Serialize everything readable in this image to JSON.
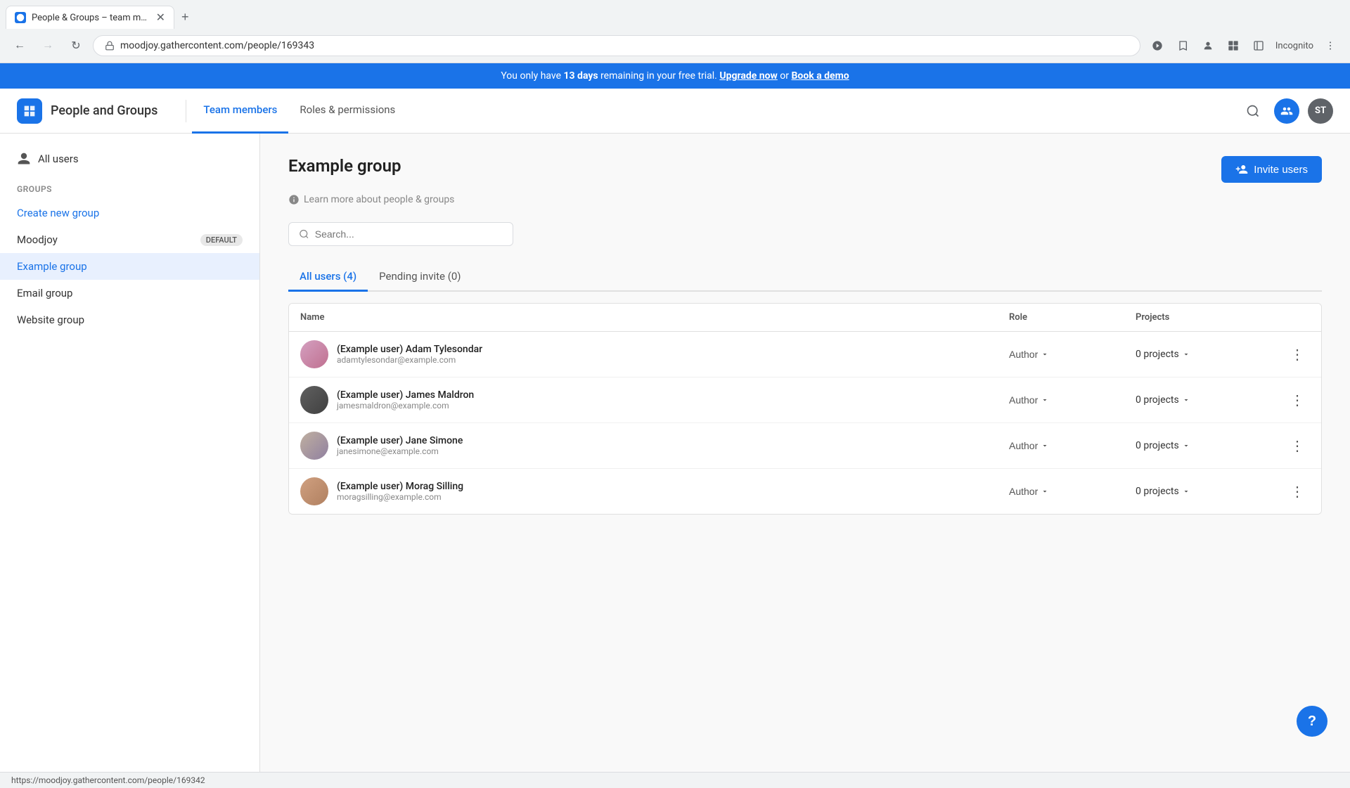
{
  "browser": {
    "tab_title": "People & Groups – team mem…",
    "favicon": "●",
    "url": "moodjoy.gathercontent.com/people/169343",
    "new_tab_label": "+",
    "back_disabled": false,
    "forward_disabled": true,
    "incognito_label": "Incognito"
  },
  "banner": {
    "text_prefix": "You only have ",
    "days": "13 days",
    "text_middle": " remaining in your free trial. ",
    "upgrade_label": "Upgrade now",
    "text_or": " or ",
    "demo_label": "Book a demo"
  },
  "header": {
    "app_name": "People and Groups",
    "nav_items": [
      {
        "id": "team-members",
        "label": "Team members",
        "active": true
      },
      {
        "id": "roles-permissions",
        "label": "Roles & permissions",
        "active": false
      }
    ],
    "user_initials": "ST"
  },
  "sidebar": {
    "all_users_label": "All users",
    "groups_section_label": "GROUPS",
    "create_group_label": "Create new group",
    "groups": [
      {
        "id": "moodjoy",
        "label": "Moodjoy",
        "badge": "DEFAULT",
        "active": false
      },
      {
        "id": "example-group",
        "label": "Example group",
        "active": true
      },
      {
        "id": "email-group",
        "label": "Email group",
        "active": false
      },
      {
        "id": "website-group",
        "label": "Website group",
        "active": false
      }
    ]
  },
  "content": {
    "group_title": "Example group",
    "learn_more_label": "Learn more about people & groups",
    "search_placeholder": "Search...",
    "invite_btn_label": "Invite users",
    "tabs": [
      {
        "id": "all-users",
        "label": "All users (4)",
        "active": true
      },
      {
        "id": "pending-invite",
        "label": "Pending invite (0)",
        "active": false
      }
    ],
    "table": {
      "headers": [
        "Name",
        "Role",
        "Projects",
        ""
      ],
      "rows": [
        {
          "id": "adam",
          "name": "(Example user) Adam Tylesondar",
          "email": "adamtylesondar@example.com",
          "role": "Author",
          "projects": "0 projects",
          "avatar_class": "avatar-adam"
        },
        {
          "id": "james",
          "name": "(Example user) James Maldron",
          "email": "jamesmaldron@example.com",
          "role": "Author",
          "projects": "0 projects",
          "avatar_class": "avatar-james"
        },
        {
          "id": "jane",
          "name": "(Example user) Jane Simone",
          "email": "janesimone@example.com",
          "role": "Author",
          "projects": "0 projects",
          "avatar_class": "avatar-jane"
        },
        {
          "id": "morag",
          "name": "(Example user) Morag Silling",
          "email": "moragsilling@example.com",
          "role": "Author",
          "projects": "0 projects",
          "avatar_class": "avatar-morag"
        }
      ]
    }
  },
  "help_btn_label": "?",
  "status_bar_url": "https://moodjoy.gathercontent.com/people/169342"
}
